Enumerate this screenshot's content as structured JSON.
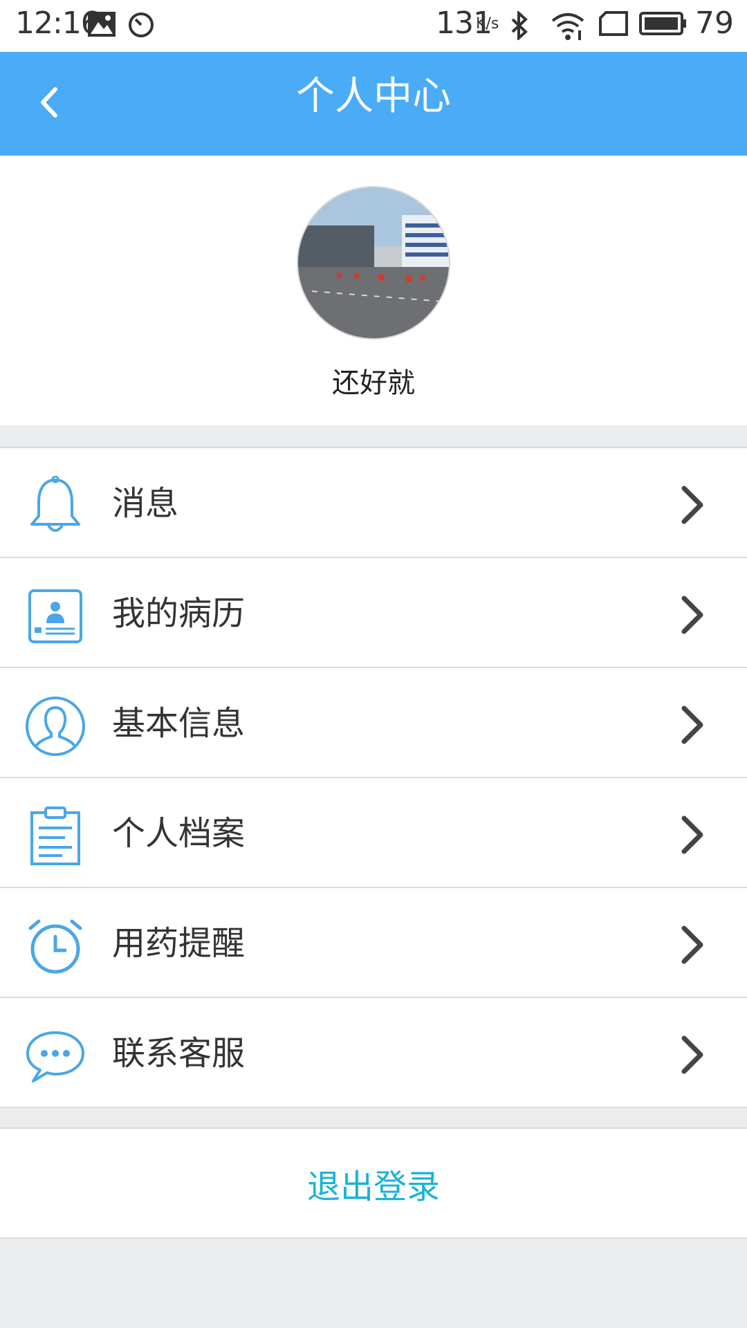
{
  "status_bar": {
    "time": "12:16",
    "network_speed": "131",
    "speed_unit": "K/s",
    "battery": "79",
    "icons": [
      "image-icon",
      "clock-icon",
      "bluetooth-icon",
      "wifi-icon",
      "sim-card-icon",
      "battery-icon"
    ]
  },
  "header": {
    "title": "个人中心",
    "back_icon": "chevron-left-icon",
    "background_color": "#4aabf7"
  },
  "profile": {
    "username": "还好就"
  },
  "menu": {
    "items": [
      {
        "label": "消息",
        "icon": "bell-icon"
      },
      {
        "label": "我的病历",
        "icon": "medical-record-icon"
      },
      {
        "label": "基本信息",
        "icon": "user-icon"
      },
      {
        "label": "个人档案",
        "icon": "clipboard-icon"
      },
      {
        "label": "用药提醒",
        "icon": "alarm-clock-icon"
      },
      {
        "label": "联系客服",
        "icon": "chat-bubble-icon"
      }
    ],
    "icon_color": "#4aa6e8",
    "chevron_color": "#444444"
  },
  "logout": {
    "label": "退出登录",
    "color": "#1ab3d8"
  }
}
